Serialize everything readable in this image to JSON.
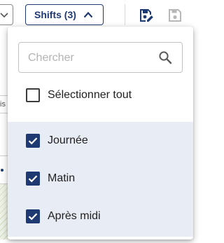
{
  "toolbar": {
    "shifts_button_label": "Shifts (3)",
    "save_as_icon": "save-edit-icon",
    "save_icon": "save-icon"
  },
  "dropdown": {
    "search": {
      "value": "",
      "placeholder": "Chercher"
    },
    "select_all": {
      "label": "Sélectionner tout",
      "checked": false
    },
    "options": [
      {
        "label": "Journée",
        "checked": true
      },
      {
        "label": "Matin",
        "checked": true
      },
      {
        "label": "Après midi",
        "checked": true
      }
    ]
  },
  "colors": {
    "accent": "#1f3a72",
    "selected_background": "#e8ecf4",
    "disabled_icon": "#b8b8b8"
  }
}
